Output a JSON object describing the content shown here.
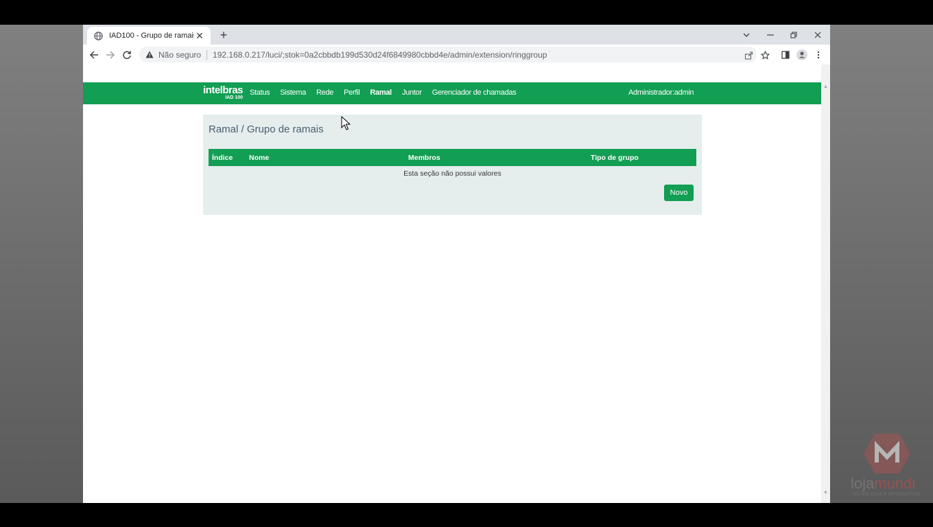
{
  "browser": {
    "tab_title": "IAD100 - Grupo de ramais",
    "not_secure_label": "Não seguro",
    "url": "192.168.0.217/luci/;stok=0a2cbbdb199d530d24f6849980cbbd4e/admin/extension/ringgroup"
  },
  "header": {
    "logo_brand": "intelbras",
    "logo_model": "IAD 100",
    "menu": [
      {
        "label": "Status"
      },
      {
        "label": "Sistema"
      },
      {
        "label": "Rede"
      },
      {
        "label": "Perfil"
      },
      {
        "label": "Ramal",
        "active": true
      },
      {
        "label": "Juntor"
      },
      {
        "label": "Gerenciador de chamadas"
      }
    ],
    "admin_label": "Administrador:admin"
  },
  "main": {
    "title": "Ramal / Grupo de ramais",
    "table": {
      "columns": [
        "Índice",
        "Nome",
        "Membros",
        "Tipo de grupo"
      ],
      "empty_message": "Esta seção não possui valores"
    },
    "new_button_label": "Novo"
  },
  "watermark": {
    "text_part1": "loja",
    "text_part2": "mundi",
    "subtext": "TECNOLOGIA E INFORMÁTICA"
  },
  "colors": {
    "brand_green": "#129e53",
    "panel_bg": "#e5eded",
    "title_text": "#4a5f6f"
  },
  "icons": {
    "tab_favicon": "globe-icon",
    "tab_close": "close-icon",
    "new_tab": "plus-icon",
    "back": "arrow-left-icon",
    "forward": "arrow-right-icon",
    "reload": "reload-icon",
    "security": "warning-triangle-icon",
    "share": "share-icon",
    "bookmark": "star-icon",
    "side_panel": "side-panel-icon",
    "profile": "profile-icon",
    "menu": "kebab-menu-icon"
  }
}
